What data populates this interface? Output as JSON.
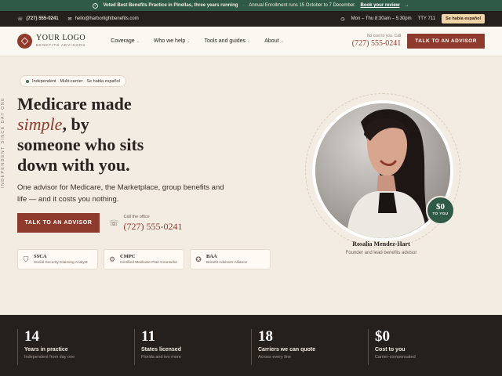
{
  "announcement": {
    "highlight": "Voted Best Benefits Practice in Pinellas, three years running",
    "enrollment": "Annual Enrollment runs 15 October to 7 December.",
    "review_link": "Book your review"
  },
  "utility": {
    "phone": "(727) 555-0241",
    "email": "hello@harborlightbenefits.com",
    "hours": "Mon – Thu 8:30am – 5:30pm",
    "tty": "TTY 711",
    "spanish": "Se habla español"
  },
  "header": {
    "logo_title": "YOUR LOGO",
    "logo_subtitle": "BENEFITS ADVISORS",
    "nav": [
      "Coverage",
      "Who we help",
      "Tools and guides",
      "About"
    ],
    "call_small": "No cost to you. Call",
    "call_number": "(727) 555-0241",
    "cta": "TALK TO AN ADVISOR"
  },
  "hero": {
    "side_text": "INDEPENDENT SINCE DAY ONE",
    "pill": "Independent · Multi-carrier · Se habla español",
    "title_1": "Medicare made",
    "title_em": "simple",
    "title_2": ", by",
    "title_3": "someone who sits",
    "title_4": "down with you.",
    "subtitle": "One advisor for Medicare, the Marketplace, group benefits and life — and it costs you nothing.",
    "cta": "TALK TO AN ADVISOR",
    "office_label": "Call the office",
    "office_number": "(727) 555-0241",
    "credentials": [
      {
        "abbr": "SSCA",
        "name": "Social Security Claiming Analyst",
        "icon": "shield-icon"
      },
      {
        "abbr": "CMPC",
        "name": "Certified Medicare Plan Counselor",
        "icon": "gear-icon"
      },
      {
        "abbr": "BAA",
        "name": "Benefit Advisors Alliance",
        "icon": "award-icon"
      }
    ]
  },
  "advisor": {
    "name": "Rosalía Mendez-Hart",
    "role": "Founder and lead benefits advisor",
    "badge_value": "$0",
    "badge_label": "TO YOU"
  },
  "stats": [
    {
      "value": "14",
      "label": "Years in practice",
      "sub": "Independent from day one"
    },
    {
      "value": "11",
      "label": "States licensed",
      "sub": "Florida and ten more"
    },
    {
      "value": "18",
      "label": "Carriers we can quote",
      "sub": "Across every line"
    },
    {
      "value": "$0",
      "label": "Cost to you",
      "sub": "Carrier-compensated"
    }
  ],
  "colors": {
    "brand": "#8e3a2c",
    "green": "#2f5a45",
    "dark": "#26201d",
    "cream": "#f3ece2"
  }
}
